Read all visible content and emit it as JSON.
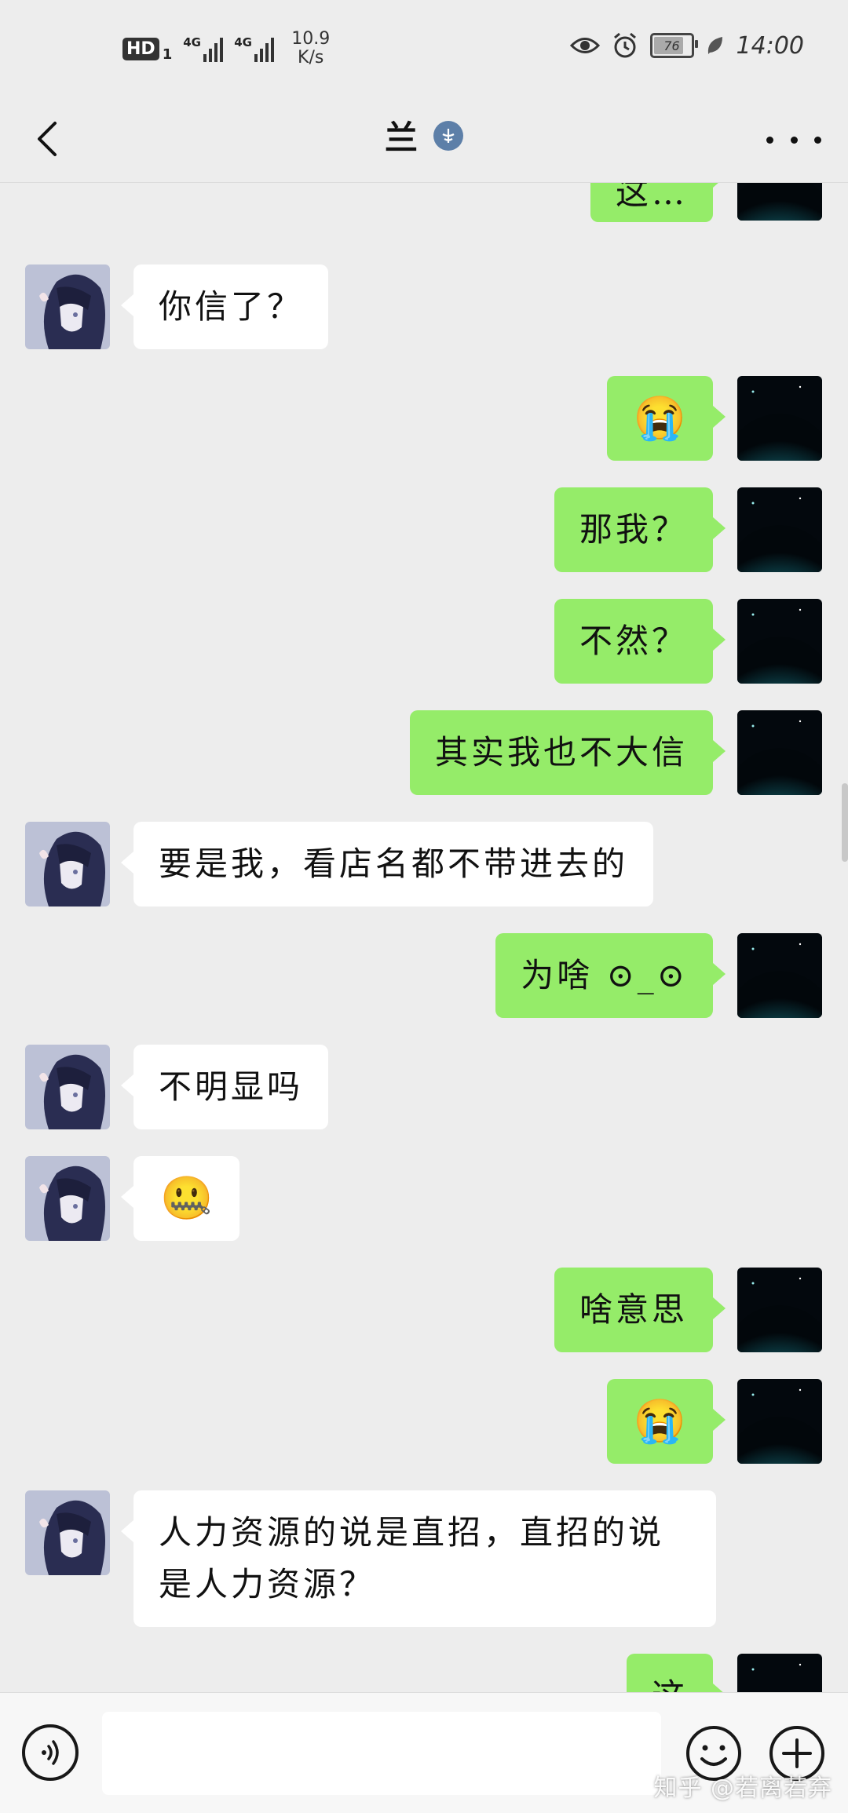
{
  "status_bar": {
    "hd_label": "HD",
    "hd_sub": "1",
    "sim1_tag": "4G",
    "sim2_tag": "4G",
    "net_speed_value": "10.9",
    "net_speed_unit": "K/s",
    "battery": "76",
    "time": "14:00"
  },
  "header": {
    "title": "兰",
    "back_icon": "chevron-left-icon",
    "more_icon": "more-dots-icon"
  },
  "messages": [
    {
      "side": "out",
      "text": "这…",
      "partial": "top"
    },
    {
      "side": "in",
      "text": "你信了？"
    },
    {
      "side": "out",
      "text": "😭",
      "emoji": true
    },
    {
      "side": "out",
      "text": "那我？"
    },
    {
      "side": "out",
      "text": "不然？"
    },
    {
      "side": "out",
      "text": "其实我也不大信"
    },
    {
      "side": "in",
      "text": "要是我，看店名都不带进去的"
    },
    {
      "side": "out",
      "text": "为啥 ⊙_⊙"
    },
    {
      "side": "in",
      "text": "不明显吗"
    },
    {
      "side": "in",
      "text": "🤐",
      "emoji": true
    },
    {
      "side": "out",
      "text": "啥意思"
    },
    {
      "side": "out",
      "text": "😭",
      "emoji": true
    },
    {
      "side": "in",
      "text": "人力资源的说是直招，直招的说是人力资源？"
    },
    {
      "side": "out",
      "text": "这",
      "partial": "bottom"
    }
  ],
  "input_bar": {
    "voice_icon": "voice-icon",
    "emoji_icon": "emoji-face-icon",
    "plus_icon": "plus-circle-icon",
    "input_value": ""
  },
  "watermark": "知乎 @若离若弃",
  "colors": {
    "background": "#ededed",
    "outgoing_bubble": "#95ec69",
    "incoming_bubble": "#ffffff"
  }
}
